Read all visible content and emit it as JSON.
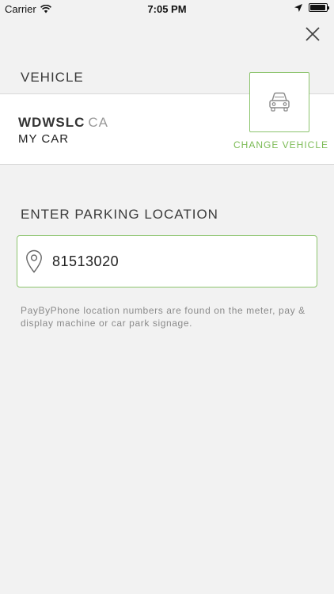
{
  "status_bar": {
    "carrier": "Carrier",
    "time": "7:05 PM",
    "battery_level": 0.95
  },
  "vehicle": {
    "section_label": "VEHICLE",
    "plate_number": "WDWSLC",
    "plate_state": "CA",
    "name": "MY CAR",
    "change_label": "CHANGE VEHICLE"
  },
  "parking": {
    "section_label": "ENTER PARKING LOCATION",
    "location_value": "81513020",
    "help_text": "PayByPhone location numbers are found on the meter, pay & display machine or car park signage."
  },
  "colors": {
    "accent": "#7bbb55",
    "border_accent": "#8cc46d",
    "background": "#f2f2f2"
  },
  "icons": [
    "wifi-icon",
    "location-arrow-icon",
    "battery-icon",
    "close-icon",
    "car-icon",
    "location-pin-icon"
  ]
}
